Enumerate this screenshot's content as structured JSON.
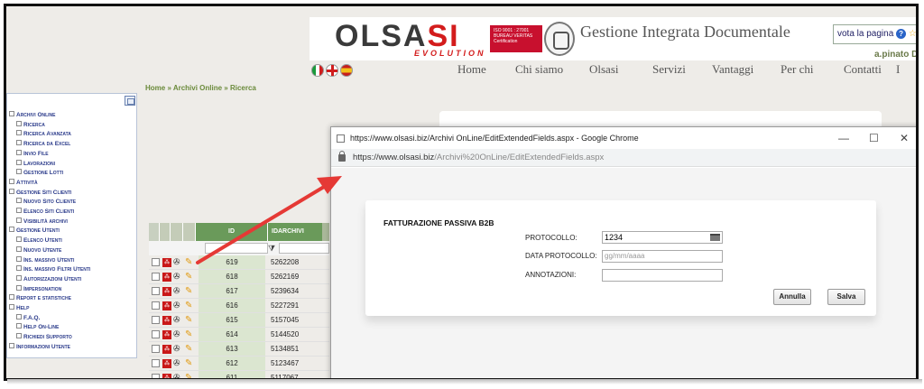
{
  "header": {
    "logo_main": "OLSA",
    "logo_accent": "SI",
    "logo_sub": "EVOLUTION",
    "cert_text": "ISO 9001 : 27001 BUREAU VERITAS Certification",
    "site_title": "Gestione Integrata Documentale",
    "vota_label": "vota la pagina",
    "help_icon": "?",
    "stars": "☆☆",
    "user": "a.pinato D",
    "flags": [
      "italy-flag-icon",
      "uk-flag-icon",
      "spain-flag-icon"
    ],
    "nav": [
      "Home",
      "Chi siamo",
      "Olsasi",
      "Servizi",
      "Vantaggi",
      "Per chi",
      "Contatti",
      "I"
    ]
  },
  "breadcrumb": "Home » Archivi Online » Ricerca",
  "sidebar": {
    "items": [
      {
        "label": "Archivi Online",
        "level": 0
      },
      {
        "label": "Ricerca",
        "level": 1
      },
      {
        "label": "Ricerca Avanzata",
        "level": 1
      },
      {
        "label": "Ricerca da Excel",
        "level": 1
      },
      {
        "label": "Invio File",
        "level": 1
      },
      {
        "label": "Lavorazioni",
        "level": 1
      },
      {
        "label": "Gestione Lotti",
        "level": 1
      },
      {
        "label": "Attività",
        "level": 0
      },
      {
        "label": "Gestione Siti Clienti",
        "level": 0
      },
      {
        "label": "Nuovo Sito Cliente",
        "level": 1
      },
      {
        "label": "Elenco Siti Clienti",
        "level": 1
      },
      {
        "label": "Visibilità archivi",
        "level": 1
      },
      {
        "label": "Gestione Utenti",
        "level": 0
      },
      {
        "label": "Elenco Utenti",
        "level": 1
      },
      {
        "label": "Nuovo Utente",
        "level": 1
      },
      {
        "label": "Ins. massivo Utenti",
        "level": 1
      },
      {
        "label": "Ins. massivo Filtri Utenti",
        "level": 1
      },
      {
        "label": "Autorizzazioni Utenti",
        "level": 1
      },
      {
        "label": "Impersonation",
        "level": 1
      },
      {
        "label": "Report e statistiche",
        "level": 0
      },
      {
        "label": "Help",
        "level": 0
      },
      {
        "label": "F.A.Q.",
        "level": 1
      },
      {
        "label": "Help On-Line",
        "level": 1
      },
      {
        "label": "Richiedi Supporto",
        "level": 1
      },
      {
        "label": "Informazioni Utente",
        "level": 0
      }
    ]
  },
  "table": {
    "col_id": "ID",
    "col_idarchivio": "IDARCHIVI",
    "rows": [
      {
        "id": "619",
        "idarchivio": "5262208"
      },
      {
        "id": "618",
        "idarchivio": "5262169"
      },
      {
        "id": "617",
        "idarchivio": "5239634"
      },
      {
        "id": "616",
        "idarchivio": "5227291"
      },
      {
        "id": "615",
        "idarchivio": "5157045"
      },
      {
        "id": "614",
        "idarchivio": "5144520"
      },
      {
        "id": "613",
        "idarchivio": "5134851"
      },
      {
        "id": "612",
        "idarchivio": "5123467"
      },
      {
        "id": "611",
        "idarchivio": "5117067"
      }
    ]
  },
  "popup": {
    "window_title": "https://www.olsasi.biz/Archivi OnLine/EditExtendedFields.aspx - Google Chrome",
    "url_host": "https://www.olsasi.biz",
    "url_path": "/Archivi%20OnLine/EditExtendedFields.aspx",
    "minimize": "—",
    "maximize": "☐",
    "close": "✕",
    "form": {
      "title": "FATTURAZIONE PASSIVA B2B",
      "protocollo_label": "PROTOCOLLO:",
      "protocollo_value": "1234",
      "data_label": "DATA PROTOCOLLO:",
      "data_placeholder": "gg/mm/aaaa",
      "annotazioni_label": "ANNOTAZIONI:",
      "annotazioni_value": "",
      "annulla": "Annulla",
      "salva": "Salva"
    }
  },
  "colors": {
    "accent_red": "#d31c1c",
    "annotation_arrow": "#e53935",
    "table_header_green": "#6a9a5a",
    "sidebar_link": "#2a3a8a"
  }
}
